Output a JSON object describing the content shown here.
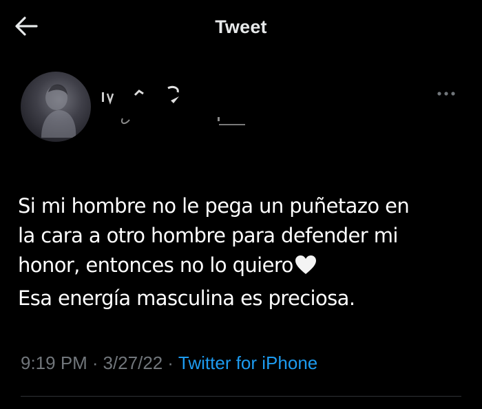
{
  "header": {
    "title": "Tweet",
    "back_icon": "arrow-left-icon"
  },
  "author": {
    "avatar_icon": "avatar-photo",
    "more_icon": "more-horizontal-icon"
  },
  "tweet": {
    "lines": [
      "Si mi hombre no le pega un puñetazo en",
      "la cara a otro hombre para defender mi",
      "honor, entonces no lo quiero",
      "Esa energía masculina es preciosa."
    ],
    "emoji": "white-heart-icon"
  },
  "meta": {
    "time": "9:19 PM",
    "separator": "·",
    "date": "3/27/22",
    "source": "Twitter for iPhone"
  },
  "colors": {
    "background": "#000000",
    "text": "#ffffff",
    "muted": "#71767b",
    "link": "#1d9bf0",
    "divider": "#2f3336"
  }
}
